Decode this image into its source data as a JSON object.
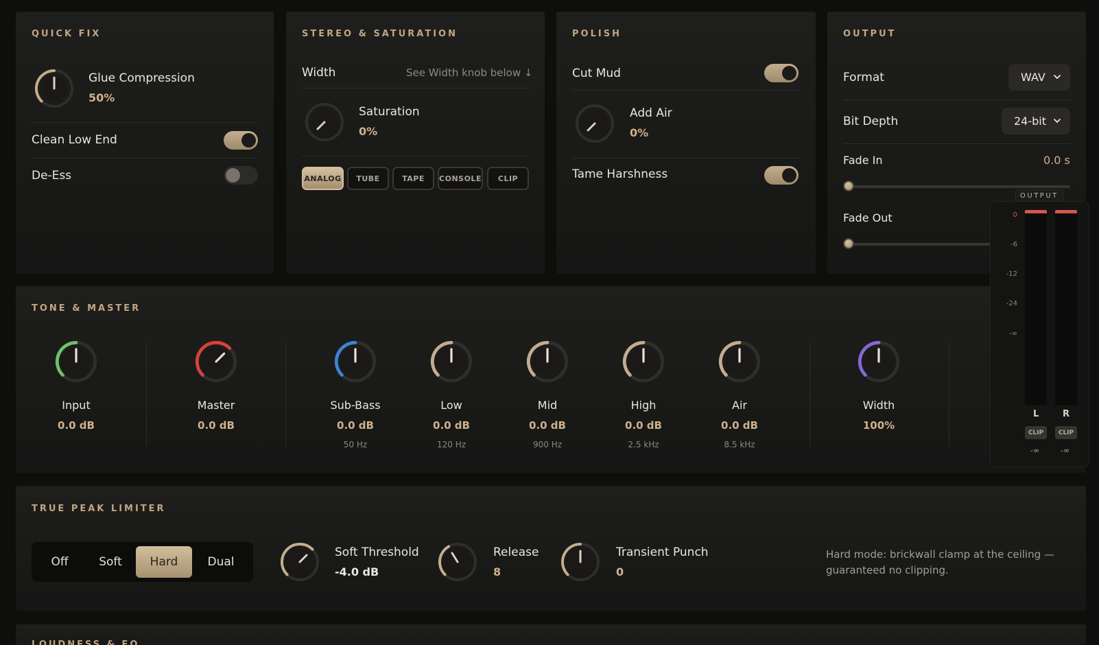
{
  "quick_fix": {
    "title": "QUICK FIX",
    "glue_label": "Glue Compression",
    "glue_value": "50%",
    "clean_low_end": "Clean Low End",
    "clean_low_end_on": true,
    "de_ess": "De-Ess",
    "de_ess_on": false
  },
  "stereo": {
    "title": "STEREO & SATURATION",
    "width_label": "Width",
    "width_hint": "See Width knob below ↓",
    "saturation_label": "Saturation",
    "saturation_value": "0%",
    "modes": [
      "ANALOG",
      "TUBE",
      "TAPE",
      "CONSOLE",
      "CLIP"
    ],
    "active_mode": "ANALOG"
  },
  "polish": {
    "title": "POLISH",
    "cut_mud": "Cut Mud",
    "cut_mud_on": true,
    "add_air_label": "Add Air",
    "add_air_value": "0%",
    "tame_harshness": "Tame Harshness",
    "tame_harshness_on": true
  },
  "output": {
    "title": "OUTPUT",
    "format_label": "Format",
    "format_value": "WAV",
    "bit_depth_label": "Bit Depth",
    "bit_depth_value": "24-bit",
    "fade_in_label": "Fade In",
    "fade_in_value": "0.0 s",
    "fade_out_label": "Fade Out"
  },
  "tone": {
    "title": "TONE & MASTER",
    "knobs": [
      {
        "label": "Input",
        "value": "0.0 dB",
        "freq": "",
        "color": "#6fc06a"
      },
      {
        "label": "Master",
        "value": "0.0 dB",
        "freq": "",
        "color": "#d8413c"
      },
      {
        "label": "Sub-Bass",
        "value": "0.0 dB",
        "freq": "50 Hz",
        "color": "#3d82d4"
      },
      {
        "label": "Low",
        "value": "0.0 dB",
        "freq": "120 Hz",
        "color": "#c4ad8d"
      },
      {
        "label": "Mid",
        "value": "0.0 dB",
        "freq": "900 Hz",
        "color": "#c4ad8d"
      },
      {
        "label": "High",
        "value": "0.0 dB",
        "freq": "2.5 kHz",
        "color": "#c4ad8d"
      },
      {
        "label": "Air",
        "value": "0.0 dB",
        "freq": "8.5 kHz",
        "color": "#c4ad8d"
      },
      {
        "label": "Width",
        "value": "100%",
        "freq": "",
        "color": "#8a67d6"
      }
    ]
  },
  "meter": {
    "title": "OUTPUT",
    "ticks": [
      "0",
      "-6",
      "-12",
      "-24",
      "-∞"
    ],
    "left_label": "L",
    "right_label": "R",
    "clip_label": "CLIP",
    "left_readout": "-∞",
    "right_readout": "-∞"
  },
  "limiter": {
    "title": "TRUE PEAK LIMITER",
    "modes": [
      "Off",
      "Soft",
      "Hard",
      "Dual"
    ],
    "active_mode": "Hard",
    "soft_threshold_label": "Soft Threshold",
    "soft_threshold_value": "-4.0 dB",
    "release_label": "Release",
    "release_value": "8",
    "punch_label": "Transient Punch",
    "punch_value": "0",
    "note": "Hard mode: brickwall clamp at the ceiling — guaranteed no clipping."
  },
  "loudness": {
    "title": "LOUDNESS & EQ"
  }
}
